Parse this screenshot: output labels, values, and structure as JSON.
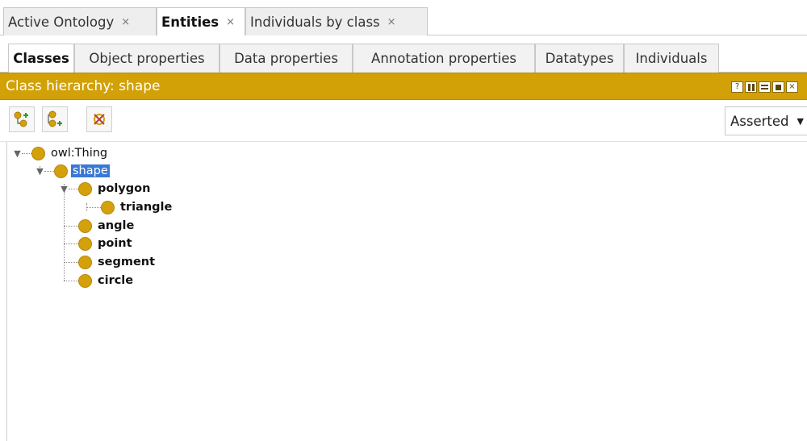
{
  "top_tabs": [
    {
      "label": "Active Ontology",
      "close": "×"
    },
    {
      "label": "Entities",
      "close": "×"
    },
    {
      "label": "Individuals by class",
      "close": "×"
    }
  ],
  "sub_tabs": [
    "Classes",
    "Object properties",
    "Data properties",
    "Annotation properties",
    "Datatypes",
    "Individuals"
  ],
  "view": {
    "title": "Class hierarchy: shape",
    "controls": [
      "help-icon",
      "split-vertical-icon",
      "split-horizontal-icon",
      "maximize-icon",
      "close-view-icon"
    ]
  },
  "toolbar": {
    "add_subclass_icon": "add-subclass-icon",
    "add_sibling_icon": "add-sibling-class-icon",
    "delete_icon": "delete-class-icon",
    "mode_select": "Asserted",
    "mode_caret": "▼"
  },
  "tree": {
    "root": "owl:Thing",
    "shape": "shape",
    "polygon": "polygon",
    "triangle": "triangle",
    "angle": "angle",
    "point": "point",
    "segment": "segment",
    "circle": "circle",
    "expand_glyph": "▼"
  },
  "colors": {
    "header": "#d2a107",
    "class_ball": "#d4a10a",
    "selection": "#3a78d6"
  }
}
